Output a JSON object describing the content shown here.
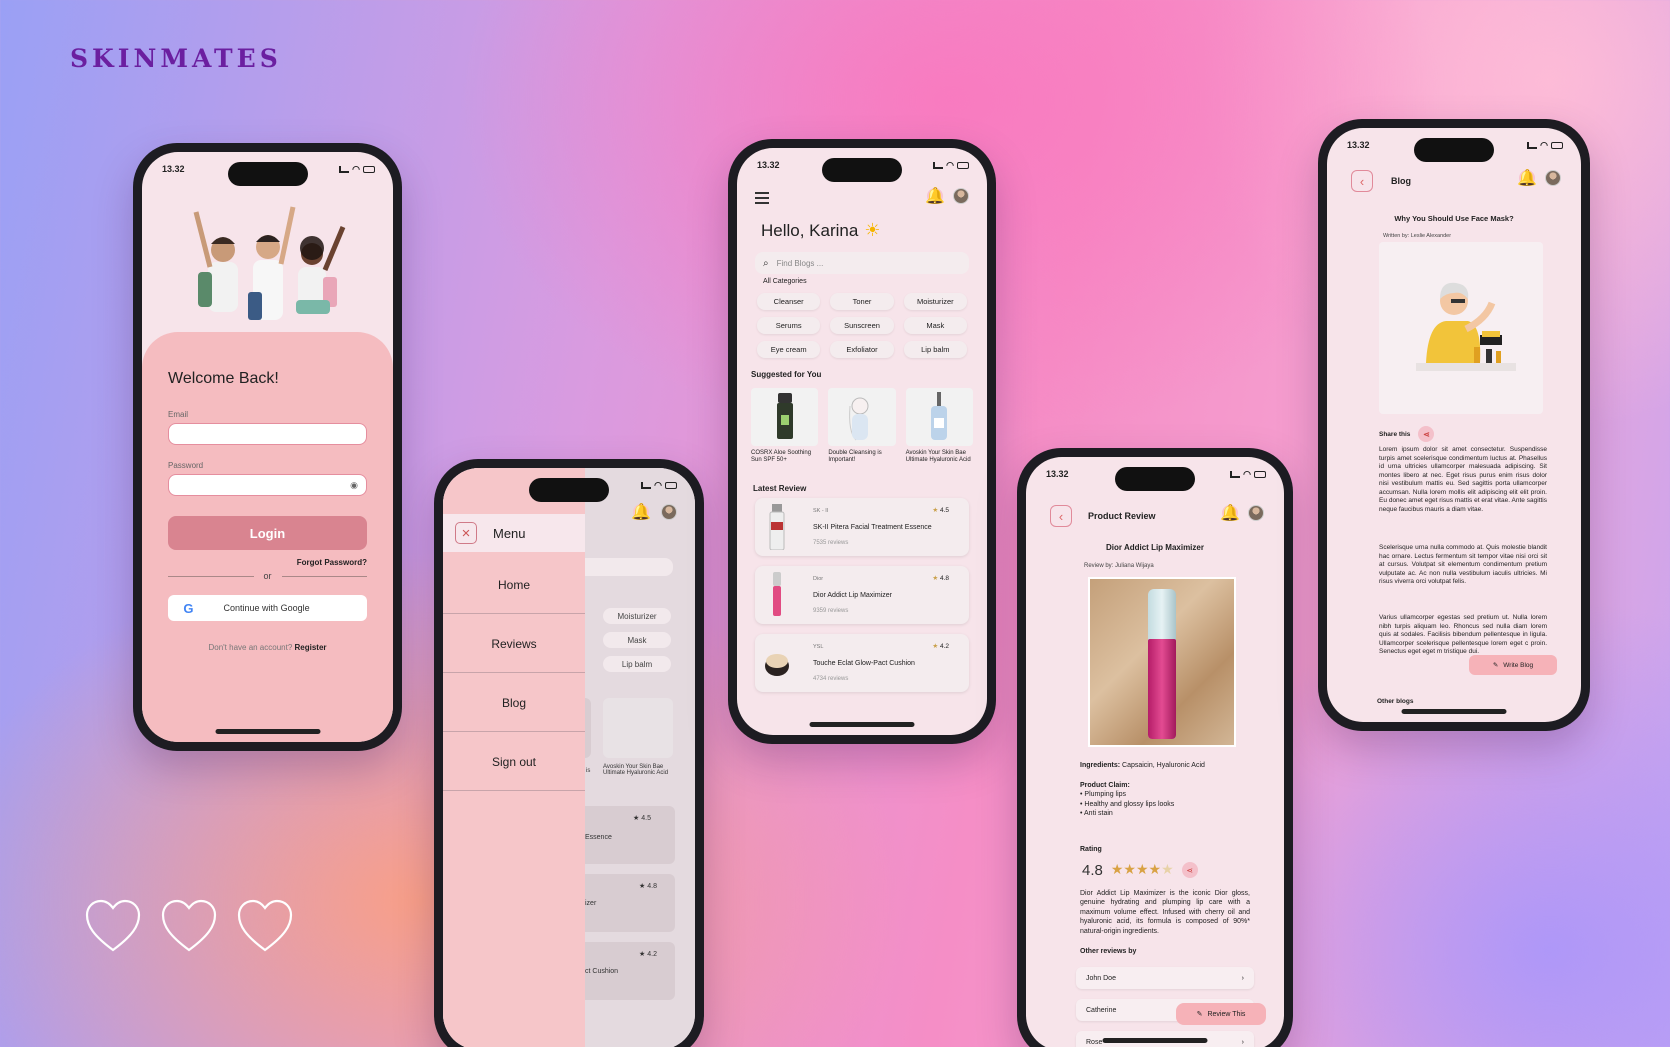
{
  "brand": "SKINMATES",
  "status_time": "13.32",
  "login": {
    "title": "Welcome Back!",
    "email_label": "Email",
    "password_label": "Password",
    "login_button": "Login",
    "forgot": "Forgot Password?",
    "or": "or",
    "google_button": "Continue with Google",
    "no_account": "Don't have an account?",
    "register": "Register"
  },
  "menu": {
    "title": "Menu",
    "items": [
      "Home",
      "Reviews",
      "Blog",
      "Sign out"
    ],
    "background": {
      "pills": [
        "Moisturizer",
        "Mask",
        "Lip balm"
      ],
      "product_text": "Avoskin Your Skin Bae Ultimate Hyaluronic Acid",
      "ratings": [
        "4.5",
        "4.8",
        "4.2"
      ],
      "fragments": [
        "Essence",
        "izer",
        "ct Cushion",
        "g is"
      ]
    }
  },
  "home": {
    "greeting": "Hello, Karina",
    "search_placeholder": "Find Blogs ...",
    "all_categories": "All Categories",
    "categories": [
      "Cleanser",
      "Toner",
      "Moisturizer",
      "Serums",
      "Sunscreen",
      "Mask",
      "Eye cream",
      "Exfoliator",
      "Lip balm"
    ],
    "suggested_heading": "Suggested for You",
    "suggested": [
      {
        "title": "COSRX Aloe Soothing Sun SPF 50+"
      },
      {
        "title": "Double Cleansing is Important!"
      },
      {
        "title": "Avoskin Your Skin Bae Ultimate Hyaluronic Acid"
      }
    ],
    "latest_heading": "Latest Review",
    "reviews": [
      {
        "brand": "SK - II",
        "name": "SK-II Pitera Facial Treatment Essence",
        "count": "7535 reviews",
        "rating": "4.5"
      },
      {
        "brand": "Dior",
        "name": "Dior Addict Lip Maximizer",
        "count": "9359 reviews",
        "rating": "4.8"
      },
      {
        "brand": "YSL",
        "name": "Touche Eclat Glow-Pact Cushion",
        "count": "4734 reviews",
        "rating": "4.2"
      }
    ]
  },
  "product_review": {
    "header": "Product Review",
    "product": "Dior Addict Lip Maximizer",
    "review_by": "Review by: Juliana Wijaya",
    "ingredients_label": "Ingredients:",
    "ingredients": "Capsaicin, Hyaluronic Acid",
    "claim_label": "Product Claim:",
    "claims": [
      "Plumping lips",
      "Healthy and glossy lips looks",
      "Anti stain"
    ],
    "rating_label": "Rating",
    "rating": "4.8",
    "stars": 4.5,
    "description": "Dior Addict Lip Maximizer is the iconic Dior gloss, genuine hydrating and plumping lip care with a maximum volume effect. Infused with cherry oil and hyaluronic acid, its formula is composed of 90%* natural-origin ingredients.",
    "other_reviews_label": "Other reviews by",
    "other_reviewers": [
      "John Doe",
      "Catherine",
      "Rose"
    ],
    "review_this": "Review This"
  },
  "blog": {
    "header": "Blog",
    "title": "Why You Should Use Face Mask?",
    "written_by": "Written by: Leslie Alexander",
    "share": "Share this",
    "paragraphs": [
      "Lorem ipsum dolor sit amet consectetur. Suspendisse turpis amet scelerisque condimentum luctus at. Phasellus id urna ultricies ullamcorper malesuada adipiscing. Sit montes libero at nec. Eget risus purus enim risus dolor nisi vestibulum mattis eu. Sed sagittis porta ullamcorper accumsan. Nulla lorem mollis elit adipiscing elit elit proin. Eu donec amet eget risus mattis et erat vitae. Ante sagittis neque faucibus mauris a diam vitae.",
      "Scelerisque urna nulla commodo at. Quis molestie blandit hac ornare. Lectus fermentum sit tempor vitae nisi orci sit at cursus. Volutpat sit elementum condimentum pretium vulputate ac. Ac non nulla vestibulum iaculis ultricies. Mi risus viverra orci volutpat felis.",
      "Varius ullamcorper egestas sed pretium ut. Nulla lorem nibh turpis aliquam leo. Rhoncus sed nulla diam lorem quis at sodales. Facilisis bibendum pellentesque in ligula. Ullamcorper scelerisque pellentesque lorem eget c proin. Senectus eget eget m tristique dui."
    ],
    "write_blog": "Write Blog",
    "other_blogs": "Other blogs"
  },
  "colors": {
    "brand": "#6b1fa0",
    "accent_pink": "#d98490",
    "card_pink": "#f5bcc0",
    "star": "#d9a244"
  }
}
